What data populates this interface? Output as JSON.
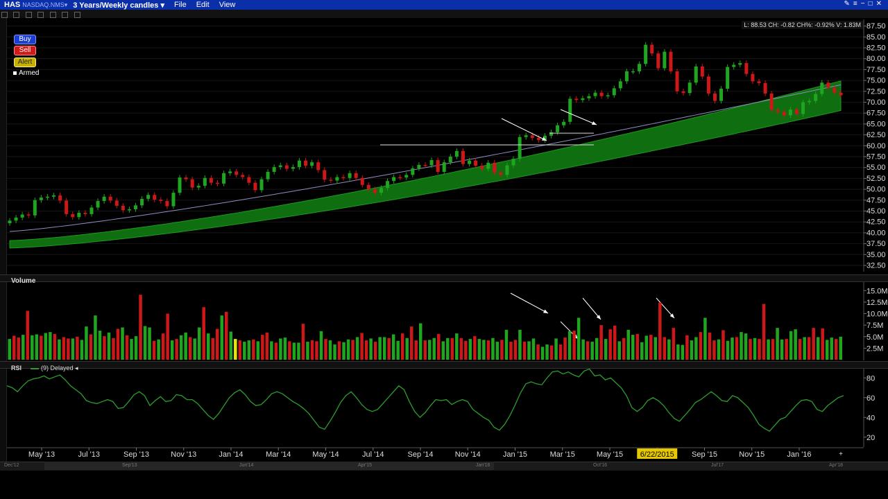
{
  "titlebar": {
    "symbol": "HAS",
    "exchange": "NASDAQ.NMS▾",
    "timeframe": "3 Years/Weekly candles ▾",
    "menu": [
      "File",
      "Edit",
      "View"
    ]
  },
  "order_buttons": {
    "buy": "Buy",
    "sell": "Sell",
    "alert": "Alert",
    "armed": "Armed"
  },
  "readout": "L: 88.53 CH: -0.82 CH%: -0.92% V: 1.83M",
  "panels": {
    "volume_label": "Volume",
    "rsi_label": "RSI",
    "rsi_legend": "(9) Delayed ◂"
  },
  "colors": {
    "up": "#1fa51f",
    "down": "#cc1818",
    "cloud": "#0f6e0f",
    "ma": "#8e8ec4",
    "rsi": "#2d9e2d",
    "annotation": "#ffffff",
    "highlight_date_bg": "#e6c800"
  },
  "chart_data": [
    {
      "type": "candlestick",
      "panel": "price",
      "ylim": [
        31.5,
        88.5
      ],
      "yticks": [
        "87.50",
        "85.00",
        "82.50",
        "80.00",
        "77.50",
        "75.00",
        "72.50",
        "70.00",
        "67.50",
        "65.00",
        "62.50",
        "60.00",
        "57.50",
        "55.00",
        "52.50",
        "50.00",
        "47.50",
        "45.00",
        "42.50",
        "40.00",
        "37.50",
        "35.00",
        "32.50"
      ],
      "closes": [
        42.8,
        43.5,
        44.2,
        44.0,
        47.5,
        48.1,
        48.3,
        48.6,
        47.4,
        44.3,
        43.6,
        44.6,
        44.3,
        45.8,
        47.3,
        48.3,
        47.4,
        46.2,
        45.2,
        45.4,
        46.3,
        47.8,
        48.7,
        47.6,
        47.3,
        46.1,
        49.2,
        52.7,
        52.3,
        50.4,
        50.8,
        52.6,
        51.5,
        51.3,
        53.7,
        54.1,
        53.3,
        52.8,
        51.5,
        49.8,
        52.3,
        54.0,
        55.1,
        55.5,
        54.7,
        55.1,
        56.6,
        55.4,
        56.2,
        54.4,
        52.2,
        52.0,
        52.8,
        52.6,
        53.7,
        52.6,
        51.0,
        50.0,
        49.2,
        50.3,
        51.9,
        52.8,
        52.7,
        53.3,
        54.8,
        55.6,
        55.5,
        56.7,
        54.0,
        56.2,
        57.5,
        58.8,
        55.8,
        56.6,
        55.4,
        54.7,
        56.1,
        53.8,
        53.3,
        55.5,
        57.0,
        62.0,
        62.4,
        61.8,
        61.3,
        62.3,
        63.1,
        64.7,
        65.5,
        70.8,
        70.5,
        70.9,
        71.4,
        72.2,
        71.4,
        71.6,
        73.2,
        74.8,
        77.1,
        77.1,
        78.8,
        83.2,
        81.2,
        77.8,
        81.6,
        77.1,
        72.5,
        72.1,
        74.5,
        78.2,
        75.9,
        72.0,
        70.3,
        73.1,
        78.1,
        78.6,
        79.0,
        76.5,
        74.8,
        74.4,
        72.0,
        68.2,
        67.8,
        67.0,
        68.3,
        67.3,
        70.0,
        70.3,
        71.9,
        74.5,
        73.3,
        72.2,
        71.6
      ],
      "ma_span": [
        40.3,
        74.0
      ],
      "cloud_top_span": [
        38.2,
        74.9
      ],
      "cloud_bottom_span": [
        36.5,
        68.1
      ],
      "horizontal_lines": [
        {
          "y": 60.2
        },
        {
          "y": 62.9
        }
      ],
      "annotation_arrows": 3
    },
    {
      "type": "bar",
      "panel": "volume",
      "ylim": [
        0,
        17
      ],
      "yticks": [
        "15.0M",
        "12.5M",
        "10.0M",
        "7.5M",
        "5.0M",
        "2.5M"
      ],
      "values": [
        4.5,
        5.2,
        4.8,
        5.4,
        10.6,
        5.3,
        5.5,
        5.2,
        5.8,
        6.0,
        5.6,
        4.4,
        4.9,
        4.6,
        4.6,
        5.0,
        4.3,
        7.2,
        5.5,
        9.6,
        6.3,
        5.1,
        5.9,
        4.7,
        6.7,
        7.0,
        5.3,
        4.5,
        5.1,
        14.1,
        7.3,
        7.0,
        4.1,
        4.4,
        5.7,
        10.0,
        4.2,
        4.5,
        5.3,
        5.9,
        4.9,
        4.6,
        7.0,
        11.4,
        5.7,
        4.7,
        6.7,
        9.6,
        10.4,
        6.1,
        4.5,
        4.2,
        3.9,
        4.2,
        4.4,
        4.0,
        5.4,
        5.9,
        4.0,
        3.7,
        4.6,
        4.8,
        4.0,
        3.7,
        3.7,
        7.8,
        3.9,
        4.2,
        4.0,
        6.2,
        4.5,
        4.2,
        3.3,
        4.0,
        3.8,
        4.4,
        4.3,
        4.9,
        5.8,
        4.2,
        4.6,
        3.9,
        4.9,
        4.9,
        4.7,
        5.5,
        4.1,
        5.7,
        4.7,
        7.2,
        4.2,
        7.9,
        4.2,
        4.3,
        4.7,
        5.6,
        4.0,
        4.7,
        4.7,
        5.7,
        4.7,
        4.1,
        4.5,
        5.1,
        4.5,
        4.3,
        4.2,
        4.7,
        3.9,
        4.3,
        6.5,
        3.9,
        4.3,
        6.5,
        3.9,
        4.0,
        4.6,
        3.3,
        2.8,
        3.3,
        3.1,
        4.6,
        3.3,
        4.8,
        6.2,
        6.3,
        9.1,
        4.4,
        4.0,
        3.9,
        4.7,
        7.5,
        4.5,
        6.6,
        7.4,
        4.0,
        4.7,
        6.5,
        5.4,
        5.6,
        3.8,
        5.2,
        5.4,
        4.9,
        12.4,
        4.9,
        4.4,
        6.9,
        3.3,
        3.2,
        5.3,
        4.2,
        4.9,
        6.0,
        9.1,
        5.9,
        4.2,
        4.4,
        6.4,
        4.1,
        4.8,
        4.9,
        6.0,
        5.7,
        4.5,
        4.7,
        4.5,
        12.1,
        4.4,
        4.5,
        6.9,
        4.4,
        4.5,
        6.2,
        6.6,
        4.5,
        4.9,
        4.9,
        6.9,
        4.9,
        6.8,
        4.3,
        4.8,
        4.5,
        5.0
      ],
      "up_flags": "geometric (bar color follows direction)",
      "highlight_bar_color": "#e6e600"
    },
    {
      "type": "line",
      "panel": "rsi",
      "ylim": [
        10,
        90
      ],
      "yticks": [
        "80",
        "60",
        "40",
        "20"
      ],
      "values": [
        72,
        70,
        66,
        72,
        77,
        79,
        80,
        82,
        79,
        81,
        83,
        78,
        72,
        68,
        64,
        57,
        55,
        54,
        56,
        58,
        56,
        49,
        50,
        56,
        63,
        66,
        62,
        52,
        57,
        61,
        56,
        57,
        63,
        62,
        58,
        58,
        54,
        48,
        42,
        38,
        44,
        52,
        60,
        65,
        68,
        63,
        56,
        52,
        53,
        58,
        64,
        66,
        64,
        60,
        56,
        53,
        49,
        44,
        37,
        30,
        28,
        36,
        45,
        55,
        62,
        66,
        60,
        53,
        48,
        46,
        48,
        54,
        60,
        66,
        72,
        68,
        56,
        46,
        40,
        45,
        52,
        58,
        57,
        58,
        53,
        56,
        58,
        56,
        48,
        44,
        40,
        37,
        30,
        27,
        33,
        42,
        53,
        65,
        74,
        76,
        74,
        73,
        80,
        86,
        87,
        84,
        86,
        83,
        81,
        87,
        89,
        82,
        83,
        78,
        80,
        75,
        70,
        62,
        50,
        46,
        50,
        57,
        60,
        57,
        52,
        45,
        39,
        36,
        42,
        48,
        55,
        58,
        62,
        66,
        62,
        57,
        56,
        62,
        60,
        55,
        50,
        42,
        33,
        29,
        26,
        32,
        38,
        40,
        46,
        52,
        57,
        58,
        56,
        48,
        46,
        52,
        56,
        60,
        62
      ],
      "curve_shape_note": "single series"
    }
  ],
  "xaxis": {
    "labels": [
      "May '13",
      "Jul '13",
      "Sep '13",
      "Nov '13",
      "Jan '14",
      "Mar '14",
      "May '14",
      "Jul '14",
      "Sep '14",
      "Nov '14",
      "Jan '15",
      "Mar '15",
      "May '15",
      "6/22/2015",
      "Sep '15",
      "Nov '15",
      "Jan '16"
    ],
    "highlight": "6/22/2015",
    "scroll_labels": [
      "Dec'12",
      "Sep'13",
      "Jun'14",
      "Apr'15",
      "Jan'16",
      "Oct'16",
      "Jul'17",
      "Apr'18"
    ]
  }
}
